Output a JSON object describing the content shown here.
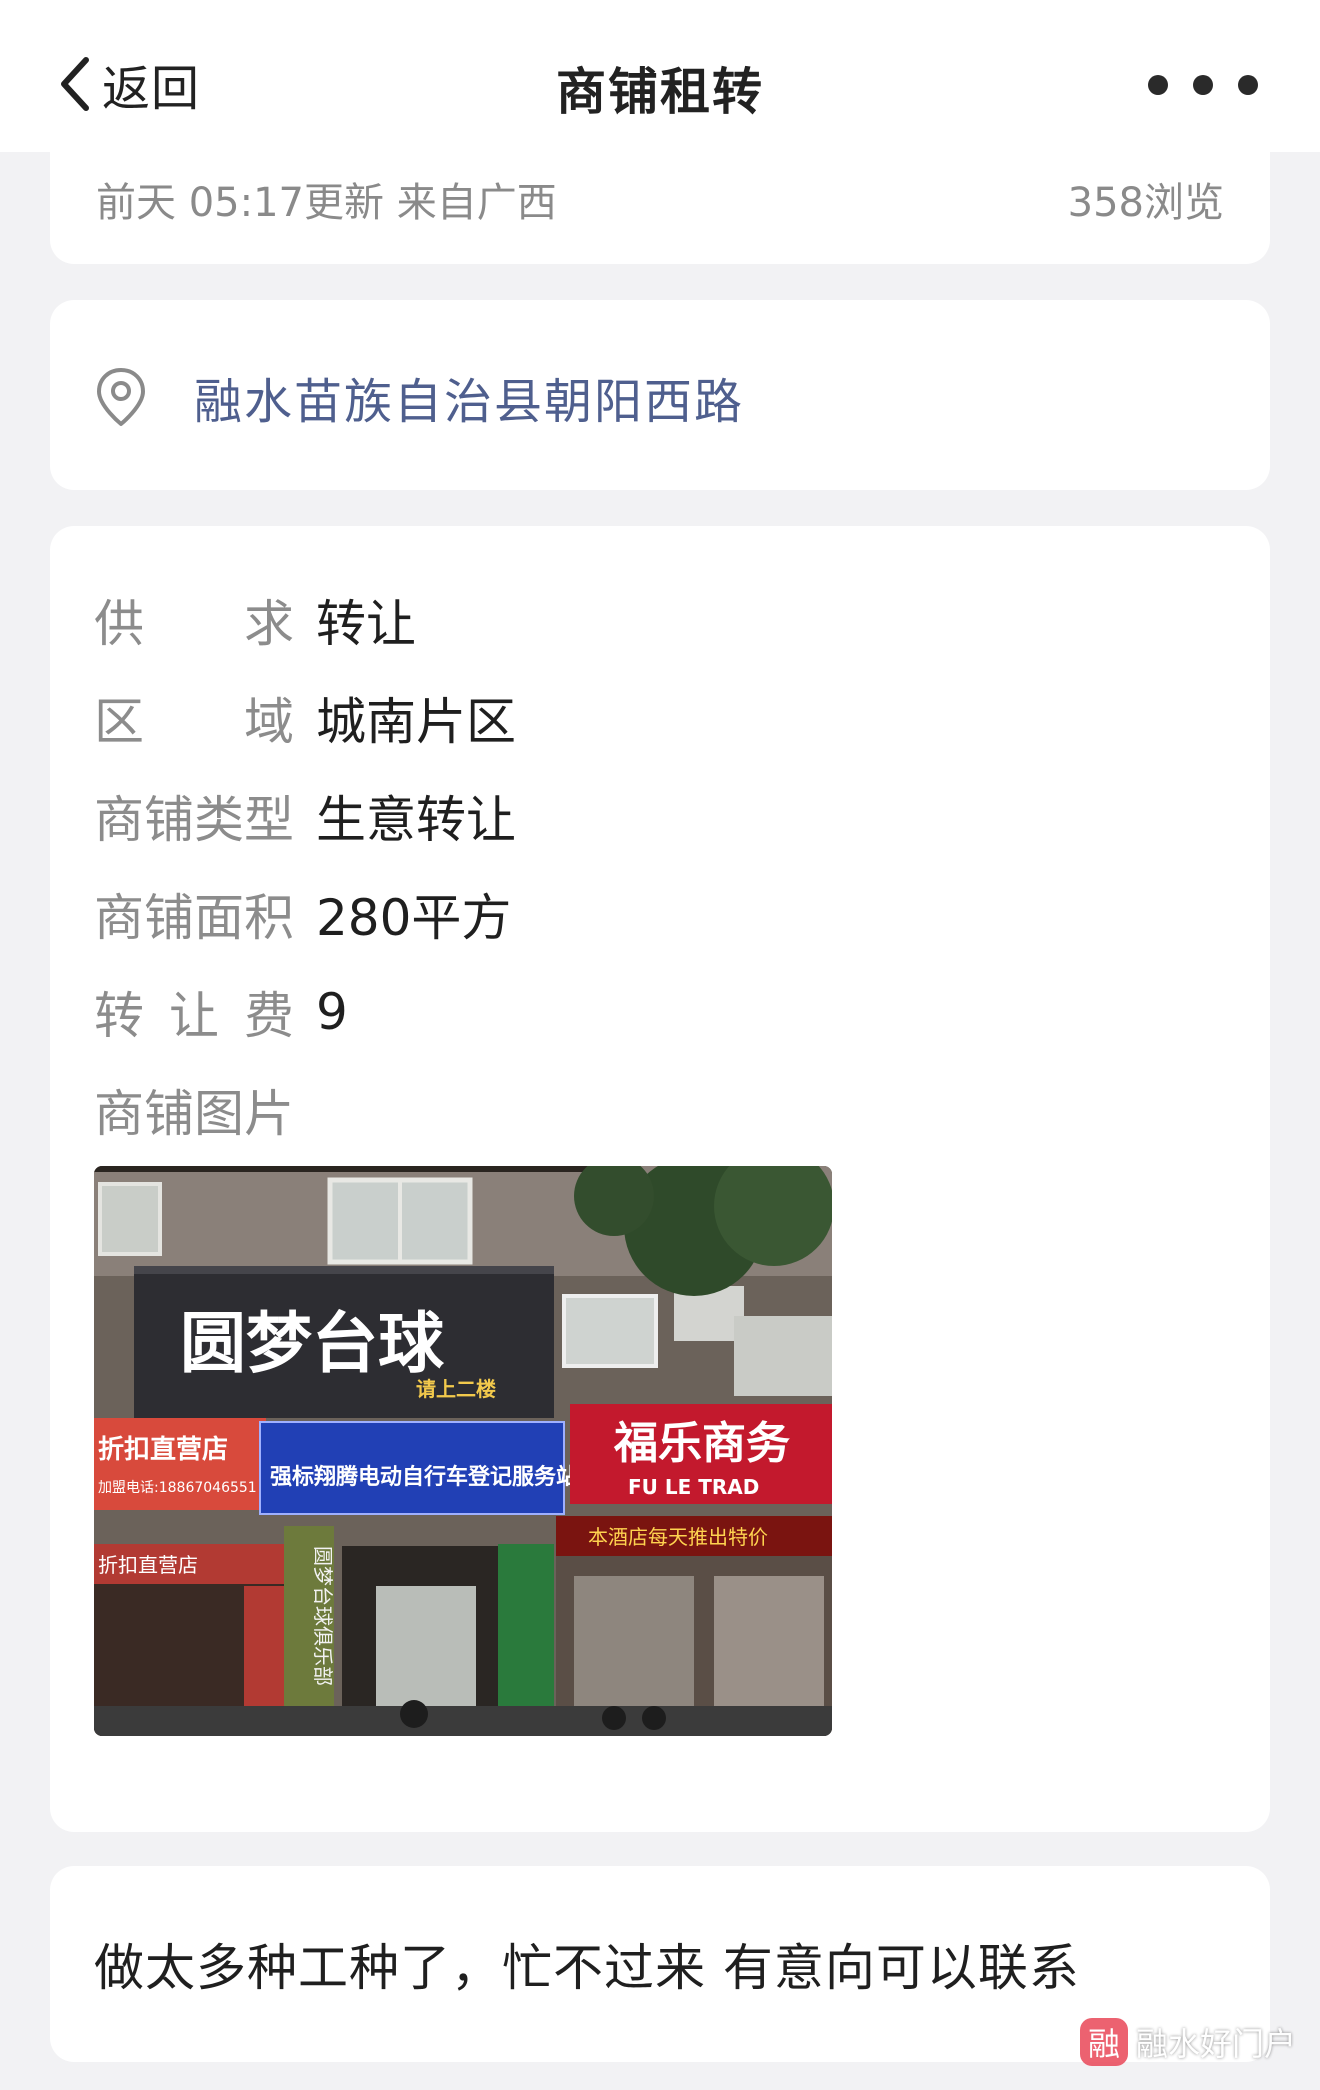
{
  "nav": {
    "back_label": "返回",
    "title": "商铺租转",
    "more_icon": "more-dots-icon"
  },
  "meta": {
    "updated": "前天 05:17更新 来自广西",
    "views": "358浏览"
  },
  "address": {
    "icon": "location-pin-icon",
    "text": "融水苗族自治县朝阳西路"
  },
  "info": {
    "rows": [
      {
        "label_chars": [
          "供",
          "求"
        ],
        "value": "转让"
      },
      {
        "label_chars": [
          "区",
          "域"
        ],
        "value": "城南片区"
      },
      {
        "label_chars": [
          "商",
          "铺",
          "类",
          "型"
        ],
        "value": "生意转让"
      },
      {
        "label_chars": [
          "商",
          "铺",
          "面",
          "积"
        ],
        "value": "280平方"
      },
      {
        "label_chars": [
          "转",
          "让",
          "费"
        ],
        "value": "9"
      },
      {
        "label_chars": [
          "商",
          "铺",
          "图",
          "片"
        ],
        "value": ""
      }
    ],
    "photo_signs": {
      "main_sign": "圆梦台球",
      "main_sign_sub": "请上二楼",
      "blue_sign": "强标翔腾电动自行车登记服务站",
      "red_sign_left": "折扣直营店",
      "red_sign_left_phone": "加盟电话:18867046551",
      "red_sign_left_lower": "折扣直营店",
      "red_sign_right": "福乐商务",
      "red_sign_right_en": "FU LE TRAD",
      "red_sign_right_scroll": "本酒店每天推出特价",
      "vertical_banner": "圆梦台球俱乐部"
    }
  },
  "description": {
    "text": "做太多种工种了，忙不过来 有意向可以联系"
  },
  "watermark": {
    "logo_char": "融",
    "text": "融水好门户"
  }
}
